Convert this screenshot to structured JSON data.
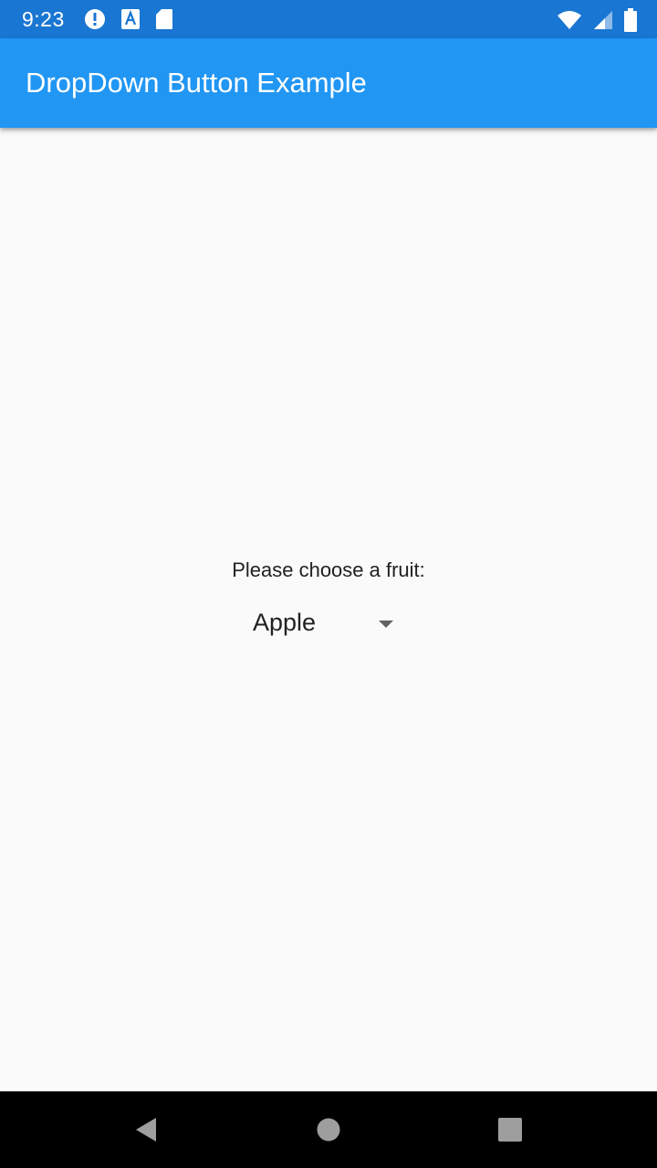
{
  "status_bar": {
    "time": "9:23",
    "icons_left": [
      "alert-icon",
      "a-notification-icon",
      "sd-card-icon"
    ],
    "icons_right": [
      "wifi-icon",
      "cell-signal-icon",
      "battery-icon"
    ]
  },
  "app_bar": {
    "title": "DropDown Button Example"
  },
  "main": {
    "prompt": "Please choose a fruit:",
    "dropdown": {
      "selected": "Apple"
    }
  },
  "nav_bar": {
    "icons": [
      "back-icon",
      "home-icon",
      "recents-icon"
    ]
  },
  "colors": {
    "status_bar": "#1976d2",
    "app_bar": "#2196f3",
    "background": "#fafafa",
    "text": "#212121"
  }
}
